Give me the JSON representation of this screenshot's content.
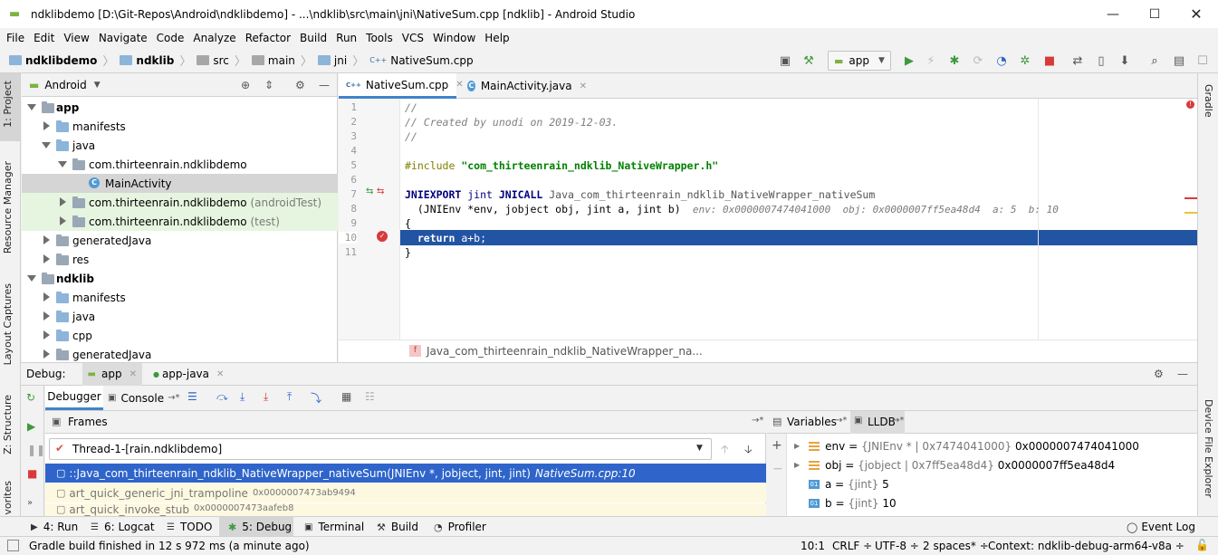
{
  "window": {
    "title": "ndklibdemo [D:\\Git-Repos\\Android\\ndklibdemo] - ...\\ndklib\\src\\main\\jni\\NativeSum.cpp [ndklib] - Android Studio"
  },
  "menu": [
    "File",
    "Edit",
    "View",
    "Navigate",
    "Code",
    "Analyze",
    "Refactor",
    "Build",
    "Run",
    "Tools",
    "VCS",
    "Window",
    "Help"
  ],
  "breadcrumb": [
    "ndklibdemo",
    "ndklib",
    "src",
    "main",
    "jni",
    "NativeSum.cpp"
  ],
  "run_config": "app",
  "left_strip": {
    "project": "1: Project",
    "resource_manager": "Resource Manager",
    "layout_captures": "Layout Captures",
    "structure": "Z: Structure",
    "favorites": "vorites"
  },
  "right_strip": {
    "gradle": "Gradle",
    "device_file_explorer": "Device File Explorer"
  },
  "project_panel": {
    "view_mode": "Android",
    "tree": [
      {
        "label": "app",
        "bold": true
      },
      {
        "label": "manifests"
      },
      {
        "label": "java"
      },
      {
        "label": "com.thirteenrain.ndklibdemo"
      },
      {
        "label": "MainActivity"
      },
      {
        "label": "com.thirteenrain.ndklibdemo",
        "suffix": "(androidTest)"
      },
      {
        "label": "com.thirteenrain.ndklibdemo",
        "suffix": "(test)"
      },
      {
        "label": "generatedJava"
      },
      {
        "label": "res"
      },
      {
        "label": "ndklib",
        "bold": true
      },
      {
        "label": "manifests"
      },
      {
        "label": "java"
      },
      {
        "label": "cpp"
      },
      {
        "label": "generatedJava"
      }
    ]
  },
  "editor": {
    "tabs": [
      "NativeSum.cpp",
      "MainActivity.java"
    ],
    "line_numbers": [
      "1",
      "2",
      "3",
      "4",
      "5",
      "6",
      "7",
      "8",
      "9",
      "10",
      "11"
    ],
    "lines": {
      "l1": "//",
      "l2": "// Created by unodi on 2019-12-03.",
      "l3": "//",
      "l5_directive": "#include ",
      "l5_string": "\"com_thirteenrain_ndklib_NativeWrapper.h\"",
      "l7_kw1": "JNIEXPORT",
      "l7_type": " jint ",
      "l7_kw2": "JNICALL",
      "l7_fn": " Java_com_thirteenrain_ndklib_NativeWrapper_nativeSum",
      "l8_code": "  (JNIEnv *env, jobject obj, jint a, jint b)",
      "l8_hint": "  env: 0x0000007474041000  obj: 0x0000007ff5ea48d4  a: 5  b: 10",
      "l9": "{",
      "l10_kw": "  return",
      "l10_rest": " a+b;",
      "l11": "}"
    },
    "footer_breadcrumb": "Java_com_thirteenrain_ndklib_NativeWrapper_na..."
  },
  "debug": {
    "label": "Debug:",
    "sessions": [
      "app",
      "app-java"
    ],
    "tabs": {
      "debugger": "Debugger",
      "console": "Console"
    },
    "frames_title": "Frames",
    "thread": "Thread-1-[rain.ndklibdemo]",
    "frames": [
      {
        "name": "::Java_com_thirteenrain_ndklib_NativeWrapper_nativeSum(JNIEnv *, jobject, jint, jint)",
        "loc": "NativeSum.cpp:10"
      },
      {
        "name": "art_quick_generic_jni_trampoline",
        "loc": "0x0000007473ab9494"
      },
      {
        "name": "art_quick_invoke_stub",
        "loc": "0x0000007473aafeb8"
      }
    ],
    "variables_title": "Variables",
    "lldb_title": "LLDB",
    "variables": [
      {
        "name": "env",
        "type": "{JNIEnv * | 0x7474041000}",
        "value": "0x0000007474041000"
      },
      {
        "name": "obj",
        "type": "{jobject | 0x7ff5ea48d4}",
        "value": "0x0000007ff5ea48d4"
      },
      {
        "name": "a",
        "type": "{jint}",
        "value": "5"
      },
      {
        "name": "b",
        "type": "{jint}",
        "value": "10"
      }
    ]
  },
  "bottom_tabs": {
    "run": "4: Run",
    "logcat": "6: Logcat",
    "todo": "TODO",
    "debug": "5: Debug",
    "terminal": "Terminal",
    "build": "Build",
    "profiler": "Profiler",
    "event_log": "Event Log"
  },
  "status": {
    "message": "Gradle build finished in 12 s 972 ms (a minute ago)",
    "position": "10:1",
    "line_sep": "CRLF ÷",
    "encoding": "UTF-8 ÷",
    "indent": "2 spaces* ÷",
    "context": "Context: ndklib-debug-arm64-v8a ÷"
  },
  "colors": {
    "accent": "#2154a3",
    "tree_green": "#e6f5df",
    "frames_yellow": "#fdf9e1",
    "debug_selected": "#2f65ca"
  }
}
